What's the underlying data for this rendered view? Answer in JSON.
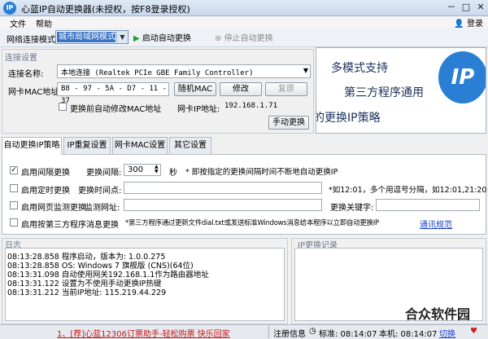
{
  "window": {
    "title": "心蓝IP自动更换器(未授权，按F8登录授权)",
    "icon_text": "IP",
    "controls": [
      "－",
      "□",
      "✕"
    ]
  },
  "menu": {
    "items": [
      "文件",
      "帮助"
    ],
    "login": "登录"
  },
  "toolbar": {
    "mode_label": "网络连接模式",
    "mode_value": "城市局域网模式",
    "start_label": "启动自动更换",
    "stop_label": "停止自动更换"
  },
  "connection": {
    "group_label": "连接设置",
    "name_label": "连接名称:",
    "name_value": "本地连接 (Realtek PCIe GBE Family Controller)",
    "mac_label": "网卡MAC地址:",
    "mac_value": "B8 - 97 - 5A - D7 - 11 - 37",
    "random_mac": "随机MAC",
    "modify": "修改",
    "restore": "复原",
    "auto_mac_label": "更换前自动修改MAC地址",
    "ip_label": "网卡IP地址:",
    "ip_value": "192.168.1.71",
    "manual_btn": "手动更换"
  },
  "ad": {
    "line1": "多模式支持",
    "line2": "第三方程序通用",
    "line3": "的更换IP策略",
    "logo": "IP"
  },
  "tabs": [
    "自动更换IP策略",
    "IP重复设置",
    "网卡MAC设置",
    "其它设置"
  ],
  "strategy": {
    "interval_label": "启用间隔更换",
    "interval_field_label": "更换间隔:",
    "interval_value": "300",
    "interval_unit": "秒",
    "interval_desc": "* 即按指定的更换间隔时间不断地自动更换IP",
    "timed_label": "启用定时更换",
    "timed_field_label": "更换时间点:",
    "timed_desc": "*如12:01，多个用逗号分隔，如12:01,21:20",
    "web_label": "启用网页监测更换",
    "web_field_label": "监测网址:",
    "keyword_label": "更换关键字:",
    "third_label": "启用按第三方程序消息更换",
    "third_desc": "*第三方程序通过更新文件dial.txt或发送标准Windows消息给本程序以立即自动更换IP",
    "comm_link": "通讯规范"
  },
  "log": {
    "label": "日志",
    "lines": [
      "08:13:28.858 程序启动，版本为: 1.0.0.275",
      "08:13:28.858 OS: Windows 7 旗舰版 (CNS)(64位)",
      "08:13:31.098 自动使用网关192.168.1.1作为路由器地址",
      "08:13:31.122 设置为不使用手动更换IP热键",
      "08:13:31.212 当前IP地址: 115.219.44.229"
    ]
  },
  "iplog": {
    "label": "IP更换记录"
  },
  "status": {
    "promo": "1、[荐]心蓝12306订票助手-轻松购票 快乐回家",
    "register": "注册信息",
    "standard_time": "标准: 08:14:07",
    "local_time": "本机: 08:14:07",
    "lang": "切换"
  },
  "watermark": "合众软件园"
}
